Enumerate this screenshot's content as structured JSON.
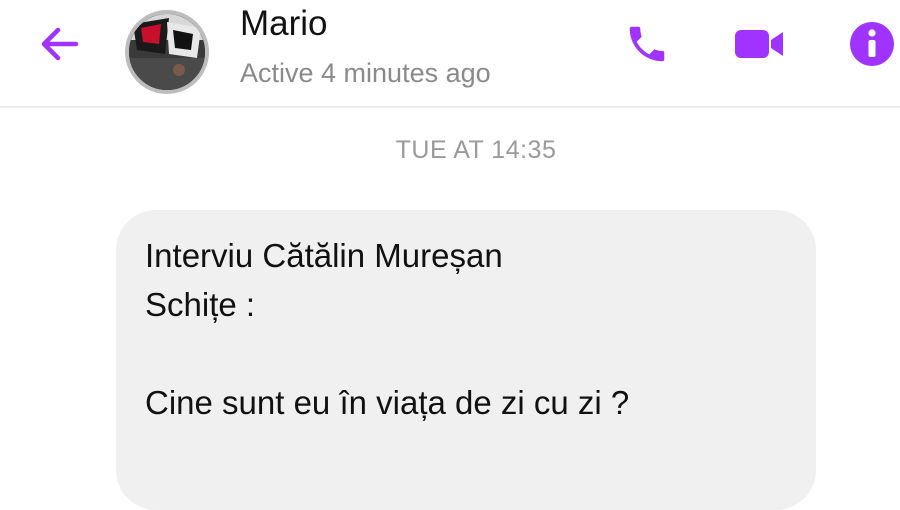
{
  "header": {
    "contact_name": "Mario",
    "status": "Active 4 minutes ago"
  },
  "icons": {
    "back": "arrow-left-icon",
    "call": "phone-icon",
    "video": "video-camera-icon",
    "info": "info-icon",
    "accent_color": "#a033ff"
  },
  "conversation": {
    "timestamp": "TUE AT 14:35",
    "message_lines": [
      "Interviu Cătălin Mureșan",
      "Schițe :",
      "Cine sunt eu în viața de zi cu zi ?"
    ]
  }
}
